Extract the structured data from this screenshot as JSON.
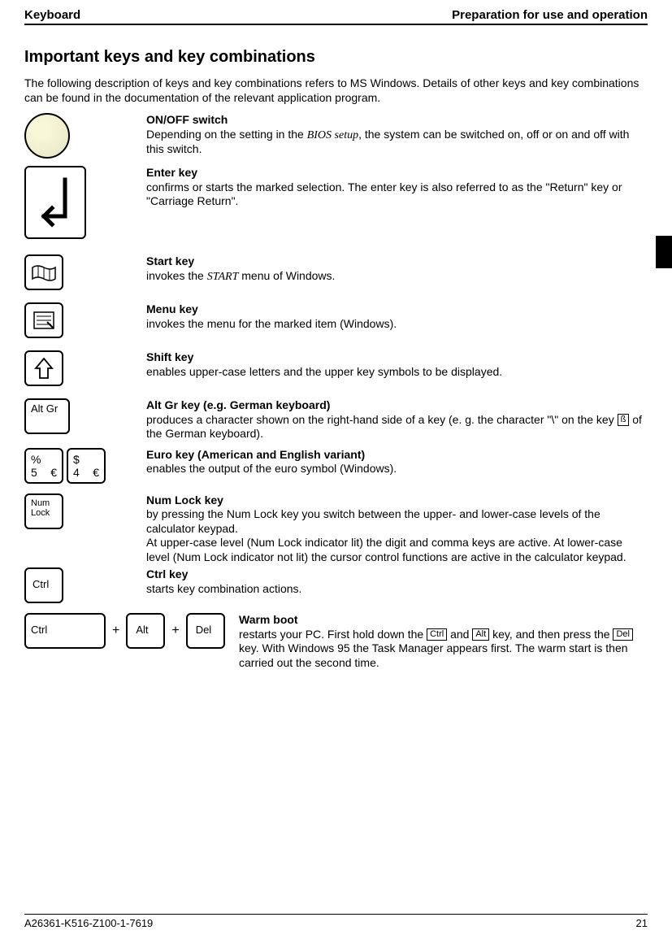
{
  "header": {
    "left": "Keyboard",
    "right": "Preparation for use and operation"
  },
  "h1": "Important keys and key combinations",
  "intro": "The following description of keys and key combinations refers to MS Windows. Details of other keys and key combinations can be found in the documentation of the relevant application program.",
  "keys": {
    "onoff": {
      "title": "ON/OFF switch",
      "body1": "Depending on the setting in the ",
      "bios": "BIOS setup",
      "body2": ", the system can be switched on, off or on and off with this switch."
    },
    "enter": {
      "title": "Enter key",
      "body": "confirms or starts the marked selection. The enter key is also referred to as the \"Return\" key or \"Carriage Return\"."
    },
    "start": {
      "title": "Start key",
      "body1": "invokes the ",
      "start_it": "START",
      "body2": " menu of Windows."
    },
    "menu": {
      "title": "Menu key",
      "body": "invokes the menu for the marked item (Windows)."
    },
    "shift": {
      "title": "Shift key",
      "body": "enables upper-case letters and the upper key symbols to be displayed."
    },
    "altgr": {
      "label": "Alt Gr",
      "title": "Alt Gr key (e.g. German keyboard)",
      "body1": "produces a character shown on the right-hand side of a key (e. g. the character \"\\\" on the key ",
      "b_key": "ß",
      "body2": " of the German keyboard)."
    },
    "euro": {
      "key5a": "%",
      "key5b": "5",
      "key4a": "$",
      "key4b": "4",
      "title": "Euro key (American and English variant)",
      "body": "enables the output of the euro symbol (Windows)."
    },
    "numlock": {
      "label1": "Num",
      "label2": "Lock",
      "title": "Num Lock key",
      "body": "by pressing the Num Lock key you switch between the upper- and lower-case levels of the calculator keypad.\nAt upper-case level (Num Lock indicator lit) the digit and comma keys are active. At lower-case level (Num Lock indicator not lit) the cursor control functions are active in the calculator keypad."
    },
    "ctrl": {
      "label": "Ctrl",
      "title": "Ctrl key",
      "body": "starts key combination actions."
    },
    "warmboot": {
      "ctrl": "Ctrl",
      "alt": "Alt",
      "del": "Del",
      "title": "Warm boot",
      "body1": "restarts your PC. First hold down the ",
      "k1": "Ctrl",
      "body2": " and ",
      "k2": "Alt",
      "body3": " key, and then press the ",
      "k3": "Del",
      "body4": " key. With Windows 95 the Task Manager appears first. The warm start is then carried out the second time."
    }
  },
  "footer": {
    "left": "A26361-K516-Z100-1-7619",
    "right": "21"
  }
}
